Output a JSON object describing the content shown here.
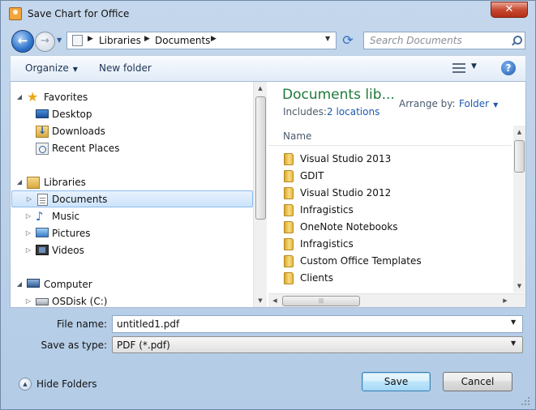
{
  "window": {
    "title": "Save Chart for Office",
    "close_glyph": "✕"
  },
  "nav": {
    "back_glyph": "←",
    "forward_glyph": "→",
    "breadcrumb": [
      "Libraries",
      "Documents"
    ],
    "search_placeholder": "Search Documents"
  },
  "toolbar": {
    "organize": "Organize",
    "new_folder": "New folder",
    "help_glyph": "?"
  },
  "nav_tree": {
    "favorites": {
      "label": "Favorites",
      "items": [
        "Desktop",
        "Downloads",
        "Recent Places"
      ]
    },
    "libraries": {
      "label": "Libraries",
      "items": [
        "Documents",
        "Music",
        "Pictures",
        "Videos"
      ]
    },
    "computer": {
      "label": "Computer",
      "items": [
        "OSDisk (C:)"
      ]
    },
    "selected": "Documents"
  },
  "file_pane": {
    "title": "Documents lib...",
    "includes_label": "Includes:",
    "locations_link": "2 locations",
    "arrange_label": "Arrange by:",
    "arrange_value": "Folder",
    "column_name": "Name",
    "items": [
      "Visual Studio 2013",
      "GDIT",
      "Visual Studio 2012",
      "Infragistics",
      "OneNote Notebooks",
      "Infragistics",
      "Custom Office Templates",
      "Clients"
    ]
  },
  "form": {
    "filename_label": "File name:",
    "filename_value": "untitled1.pdf",
    "type_label": "Save as type:",
    "type_value": "PDF (*.pdf)"
  },
  "footer": {
    "hide_folders": "Hide Folders",
    "save": "Save",
    "cancel": "Cancel"
  },
  "colors": {
    "title_green": "#1e7a3a",
    "link_blue": "#1c5bb0",
    "frame_blue": "#c4d7ec"
  }
}
